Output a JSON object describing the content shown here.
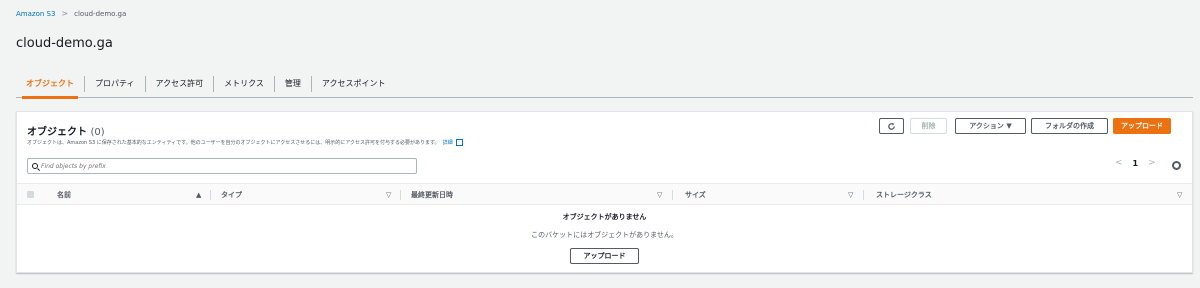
{
  "breadcrumb": {
    "root": "Amazon S3",
    "separator": ">",
    "current": "cloud-demo.ga"
  },
  "page_title": "cloud-demo.ga",
  "tabs": [
    {
      "label": "オブジェクト",
      "active": true
    },
    {
      "label": "プロパティ"
    },
    {
      "label": "アクセス許可"
    },
    {
      "label": "メトリクス"
    },
    {
      "label": "管理"
    },
    {
      "label": "アクセスポイント"
    }
  ],
  "panel": {
    "title": "オブジェクト",
    "count": "(0)",
    "description": "オブジェクトは、Amazon S3 に保存された基本的なエンティティです。他のユーザーを自分のオブジェクトにアクセスさせるには、明示的にアクセス許可を付与する必要があります。",
    "info_link": "詳細",
    "buttons": {
      "delete": "削除",
      "actions": "アクション ▼",
      "create_folder": "フォルダの作成",
      "upload": "アップロード"
    },
    "search_placeholder": "Find objects by prefix",
    "pager": {
      "prev": "<",
      "page": "1",
      "next": ">"
    }
  },
  "table": {
    "columns": [
      "名前",
      "タイプ",
      "最終更新日時",
      "サイズ",
      "ストレージクラス"
    ],
    "empty_title": "オブジェクトがありません",
    "empty_desc": "このバケットにはオブジェクトがありません。",
    "empty_upload": "アップロード"
  },
  "colors": {
    "accent": "#ec7211",
    "link": "#0073bb"
  }
}
